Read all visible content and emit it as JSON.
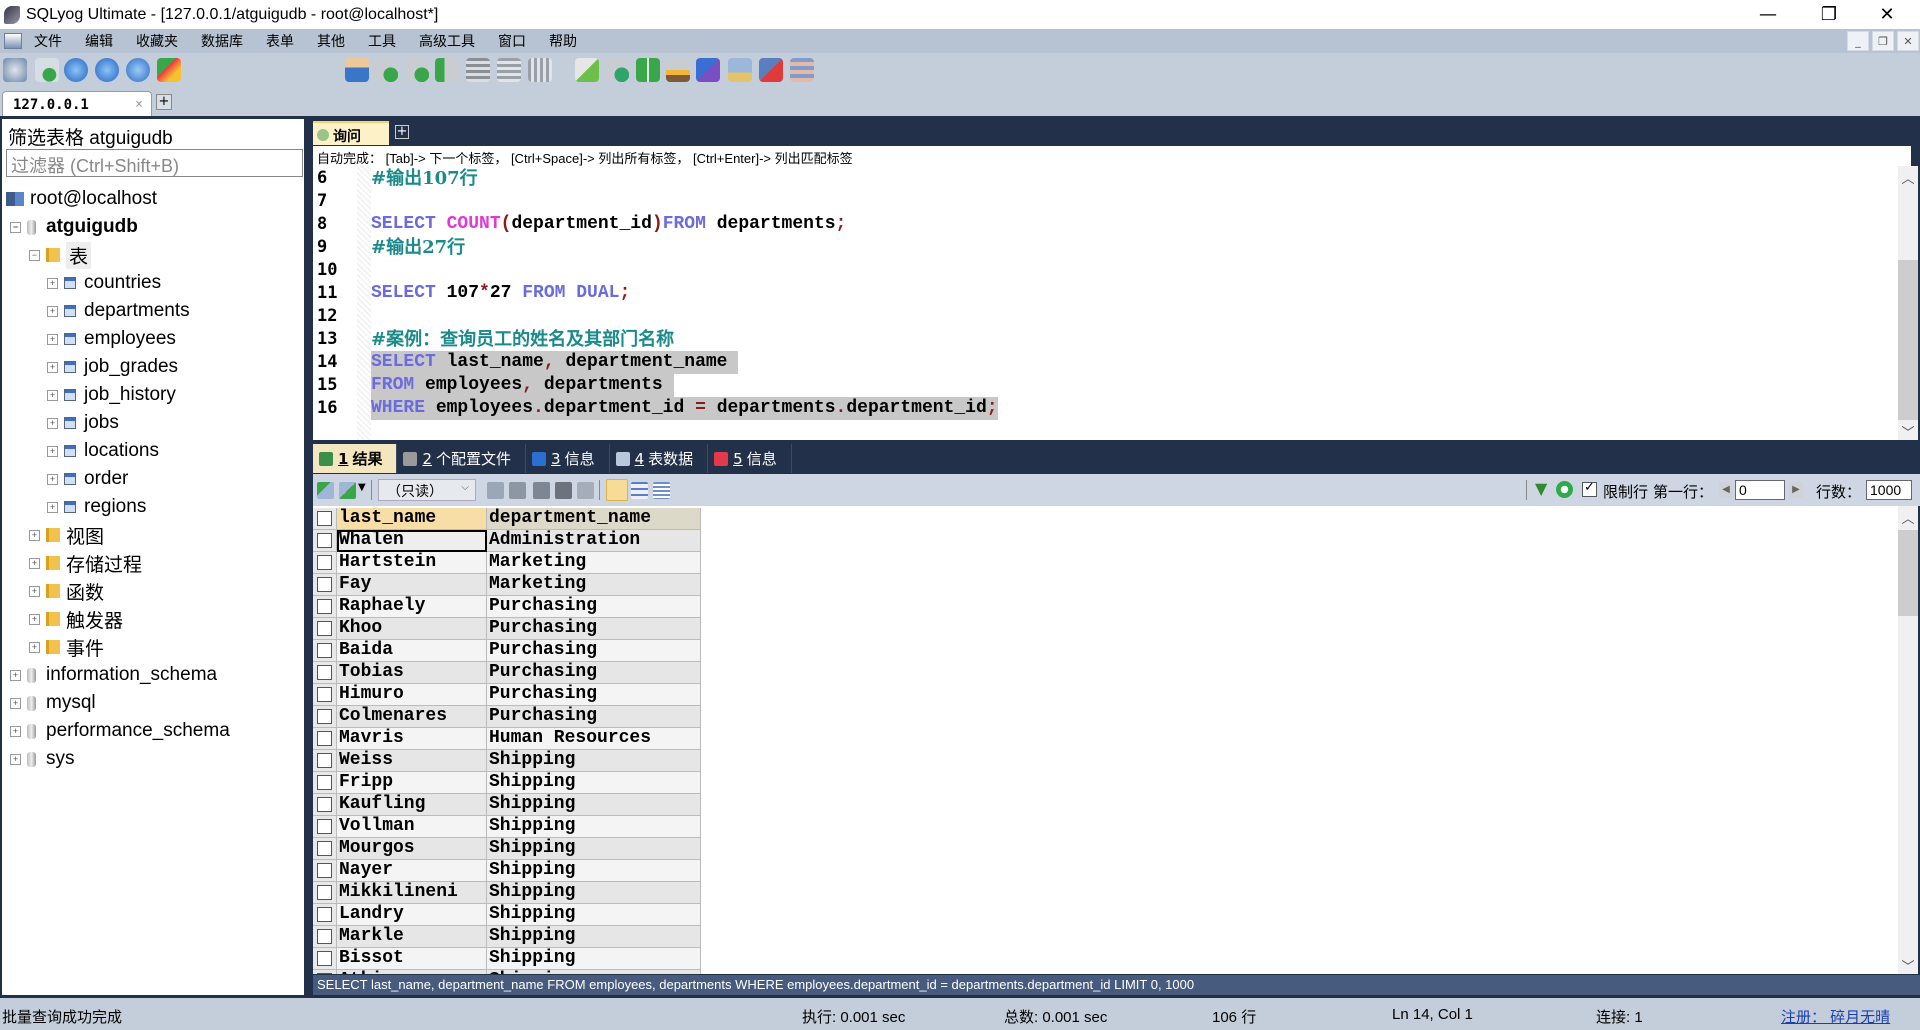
{
  "window": {
    "title": "SQLyog Ultimate - [127.0.0.1/atguigudb - root@localhost*]",
    "controls": [
      "minimize",
      "restore",
      "close"
    ]
  },
  "menu": {
    "items": [
      "文件",
      "编辑",
      "收藏夹",
      "数据库",
      "表单",
      "其他",
      "工具",
      "高级工具",
      "窗口",
      "帮助"
    ]
  },
  "toolbar": {
    "database_selected": "atguigudb",
    "icons": [
      "new-connection-icon",
      "new-query-icon",
      "execute-query-icon",
      "execute-all-icon",
      "execute-edit-icon",
      "refresh-object-icon",
      "user-manager-icon",
      "backup-db-icon",
      "restore-db-icon",
      "import-csv-icon",
      "export-table-icon",
      "table-data-icon",
      "copy-table-icon",
      "schema-sync-icon",
      "db-sync-icon",
      "data-compare-icon",
      "migration-icon",
      "scheduled-job-icon",
      "notification-icon",
      "visual-query-icon",
      "schema-designer-icon"
    ]
  },
  "connection_tabs": [
    {
      "label": "127.0.0.1",
      "close": "×"
    }
  ],
  "add_tab_symbol": "+",
  "sidebar": {
    "filter_title": "筛选表格 atguigudb",
    "filter_placeholder": "过滤器 (Ctrl+Shift+B)",
    "server": "root@localhost",
    "database": "atguigudb",
    "tables_folder": "表",
    "tables": [
      "countries",
      "departments",
      "employees",
      "job_grades",
      "job_history",
      "jobs",
      "locations",
      "order",
      "regions"
    ],
    "folders": [
      "视图",
      "存储过程",
      "函数",
      "触发器",
      "事件"
    ],
    "other_databases": [
      "information_schema",
      "mysql",
      "performance_schema",
      "sys"
    ]
  },
  "query_tab": {
    "label": "询问",
    "autocomplete_hint": "自动完成：  [Tab]-> 下一个标签，  [Ctrl+Space]-> 列出所有标签，  [Ctrl+Enter]-> 列出匹配标签"
  },
  "editor": {
    "lines": [
      {
        "n": "6",
        "segments": [
          {
            "t": "#输出107行",
            "c": "cm"
          }
        ]
      },
      {
        "n": "7",
        "segments": []
      },
      {
        "n": "8",
        "segments": [
          {
            "t": "SELECT",
            "c": "kw"
          },
          {
            "t": " ",
            "c": ""
          },
          {
            "t": "COUNT",
            "c": "fn"
          },
          {
            "t": "(",
            "c": "pn"
          },
          {
            "t": "department_id",
            "c": ""
          },
          {
            "t": ")",
            "c": "pn"
          },
          {
            "t": "FROM",
            "c": "kw"
          },
          {
            "t": " departments",
            "c": ""
          },
          {
            "t": ";",
            "c": "pn"
          }
        ]
      },
      {
        "n": "9",
        "segments": [
          {
            "t": "#输出27行",
            "c": "cm"
          }
        ]
      },
      {
        "n": "10",
        "segments": []
      },
      {
        "n": "11",
        "segments": [
          {
            "t": "SELECT",
            "c": "kw"
          },
          {
            "t": " 107",
            "c": ""
          },
          {
            "t": "*",
            "c": "pn"
          },
          {
            "t": "27 ",
            "c": ""
          },
          {
            "t": "FROM DUAL",
            "c": "kw"
          },
          {
            "t": ";",
            "c": "pn"
          }
        ]
      },
      {
        "n": "12",
        "segments": []
      },
      {
        "n": "13",
        "segments": [
          {
            "t": "#案例：查询员工的姓名及其部门名称",
            "c": "cm"
          }
        ]
      },
      {
        "n": "14",
        "sel": true,
        "segments": [
          {
            "t": "SELECT",
            "c": "kw"
          },
          {
            "t": " last_name",
            "c": ""
          },
          {
            "t": ",",
            "c": "pn"
          },
          {
            "t": " department_name ",
            "c": ""
          }
        ]
      },
      {
        "n": "15",
        "sel": true,
        "segments": [
          {
            "t": "FROM",
            "c": "kw"
          },
          {
            "t": " employees",
            "c": ""
          },
          {
            "t": ",",
            "c": "pn"
          },
          {
            "t": " departments ",
            "c": ""
          }
        ]
      },
      {
        "n": "16",
        "sel": true,
        "segments": [
          {
            "t": "WHERE",
            "c": "kw"
          },
          {
            "t": " employees",
            "c": ""
          },
          {
            "t": ".",
            "c": "pn"
          },
          {
            "t": "department_id ",
            "c": ""
          },
          {
            "t": "=",
            "c": "pn"
          },
          {
            "t": " departments",
            "c": ""
          },
          {
            "t": ".",
            "c": "pn"
          },
          {
            "t": "department_id",
            "c": ""
          },
          {
            "t": ";",
            "c": "pn"
          }
        ]
      }
    ]
  },
  "result_tabs": [
    {
      "num": "1",
      "label": "结果",
      "active": true,
      "color": "#3c8f4a"
    },
    {
      "num": "2",
      "label": "个配置文件",
      "active": false,
      "color": "#9a9a9a"
    },
    {
      "num": "3",
      "label": "信息",
      "active": false,
      "color": "#2c6fd0"
    },
    {
      "num": "4",
      "label": "表数据",
      "active": false,
      "color": "#b9c7dc"
    },
    {
      "num": "5",
      "label": "信息",
      "active": false,
      "color": "#e23a4a"
    }
  ],
  "result_toolbar": {
    "mode": "（只读）",
    "limit_rows_label": "限制行",
    "limit_rows_checked": true,
    "first_row_label": "第一行：",
    "first_row_value": "0",
    "row_count_label": "行数：",
    "row_count_value": "1000"
  },
  "grid": {
    "columns": [
      "last_name",
      "department_name"
    ],
    "rows": [
      [
        "Whalen",
        "Administration"
      ],
      [
        "Hartstein",
        "Marketing"
      ],
      [
        "Fay",
        "Marketing"
      ],
      [
        "Raphaely",
        "Purchasing"
      ],
      [
        "Khoo",
        "Purchasing"
      ],
      [
        "Baida",
        "Purchasing"
      ],
      [
        "Tobias",
        "Purchasing"
      ],
      [
        "Himuro",
        "Purchasing"
      ],
      [
        "Colmenares",
        "Purchasing"
      ],
      [
        "Mavris",
        "Human Resources"
      ],
      [
        "Weiss",
        "Shipping"
      ],
      [
        "Fripp",
        "Shipping"
      ],
      [
        "Kaufling",
        "Shipping"
      ],
      [
        "Vollman",
        "Shipping"
      ],
      [
        "Mourgos",
        "Shipping"
      ],
      [
        "Nayer",
        "Shipping"
      ],
      [
        "Mikkilineni",
        "Shipping"
      ],
      [
        "Landry",
        "Shipping"
      ],
      [
        "Markle",
        "Shipping"
      ],
      [
        "Bissot",
        "Shipping"
      ],
      [
        "Atkinson",
        "Shipping"
      ]
    ]
  },
  "executed_sql": "SELECT last_name, department_name FROM employees, departments WHERE employees.department_id = departments.department_id LIMIT 0, 1000",
  "status": {
    "message": "批量查询成功完成",
    "exec_time": "执行: 0.001 sec",
    "total_time": "总数: 0.001 sec",
    "rows": "106 行",
    "cursor": "Ln 14, Col 1",
    "connections": "连接: 1",
    "registration": "注册： 碎月无晴"
  }
}
